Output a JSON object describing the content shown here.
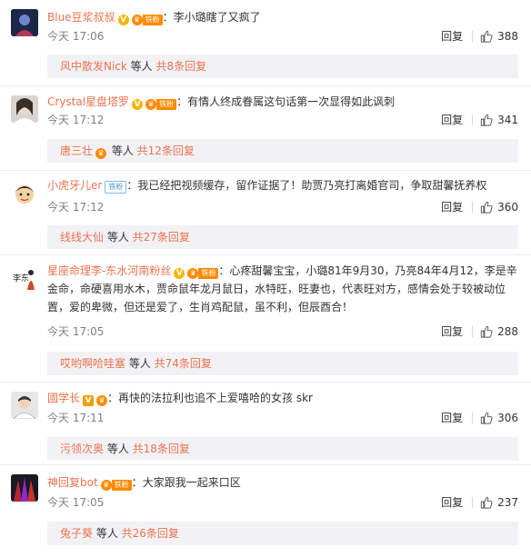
{
  "comments": [
    {
      "username": "Blue豆浆叔叔",
      "badges": {
        "vip": "V",
        "crown": "♛",
        "fan": "铁粉"
      },
      "separator": "：",
      "text": "李小璐瞎了又疯了",
      "time": "今天 17:06",
      "reply_label": "回复",
      "likes": "388",
      "thread": {
        "name": "风中散发Nick",
        "mid": " 等人 ",
        "count": "共8条回复"
      }
    },
    {
      "username": "Crystal星盘塔罗",
      "badges": {
        "vip": "V",
        "crown": "♛",
        "fan": "铁粉"
      },
      "separator": "：",
      "text": "有情人终成眷属这句话第一次显得如此讽刺",
      "time": "今天 17:12",
      "reply_label": "回复",
      "likes": "341",
      "thread": {
        "name": "唐三壮",
        "mid": " 等人 ",
        "count": "共12条回复"
      }
    },
    {
      "username": "小虎牙儿er",
      "badges": {
        "fan": "铁粉"
      },
      "separator": "：",
      "text": "我已经把视频缓存，留作证据了！助贾乃亮打离婚官司，争取甜馨抚养权",
      "time": "今天 17:12",
      "reply_label": "回复",
      "likes": "360",
      "thread": {
        "name": "线线大仙",
        "mid": " 等人 ",
        "count": "共27条回复"
      }
    },
    {
      "username": "星座命理李-东水河南粉丝",
      "badges": {
        "vip": "V",
        "crown": "♛",
        "fan": "铁粉"
      },
      "separator": "：",
      "text": "心疼甜馨宝宝，小璐81年9月30，乃亮84年4月12，李是辛金命，命硬喜用水木，贾命鼠年龙月鼠日，水特旺，旺妻也，代表旺对方，感情会处于较被动位置，爱的卑微，但还是爱了，生肖鸡配鼠，虽不利，但辰酉合！",
      "time": "今天 17:05",
      "reply_label": "回复",
      "likes": "288",
      "thread": {
        "name": "哎哟啊哈哇塞",
        "mid": " 等人 ",
        "count": "共74条回复"
      }
    },
    {
      "username": "國学长",
      "badges": {
        "vip": "V",
        "crown": "♛"
      },
      "separator": "：",
      "text": "再快的法拉利也追不上爱嘻哈的女孩 skr",
      "time": "今天 17:11",
      "reply_label": "回复",
      "likes": "306",
      "thread": {
        "name": "污领次奥",
        "mid": " 等人 ",
        "count": "共18条回复"
      }
    },
    {
      "username": "神回复bot",
      "badges": {
        "crown": "♛",
        "fan": "铁粉"
      },
      "separator": "：",
      "text": "大家跟我一起来口区",
      "time": "今天 17:05",
      "reply_label": "回复",
      "likes": "237",
      "thread": {
        "name": "兔子葵",
        "mid": " 等人 ",
        "count": "共26条回复"
      }
    }
  ],
  "colors": {
    "username": "#eb7350",
    "text": "#333333",
    "meta": "#808080",
    "reply_bg": "#f2f2f5"
  },
  "icons": {
    "like": "thumbs-up-icon"
  }
}
